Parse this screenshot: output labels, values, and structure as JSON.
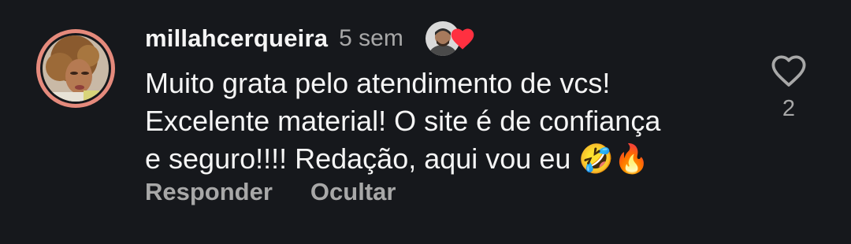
{
  "comment": {
    "username": "millahcerqueira",
    "time_ago": "5 sem",
    "text": "Muito grata pelo atendimento de vcs!\nExcelente material! O site é de confiança\ne seguro!!!! Redação, aqui vou eu 🤣🔥",
    "like_count": "2",
    "author_liked": true
  },
  "actions": {
    "reply_label": "Responder",
    "hide_label": "Ocultar"
  },
  "icons": {
    "like": "heart-outline-icon",
    "author_like": "heart-filled-icon"
  },
  "colors": {
    "background": "#16181c",
    "avatar_ring": "#e58a7c",
    "heart_red": "#ff3040",
    "muted_text": "#a8a8a8"
  }
}
